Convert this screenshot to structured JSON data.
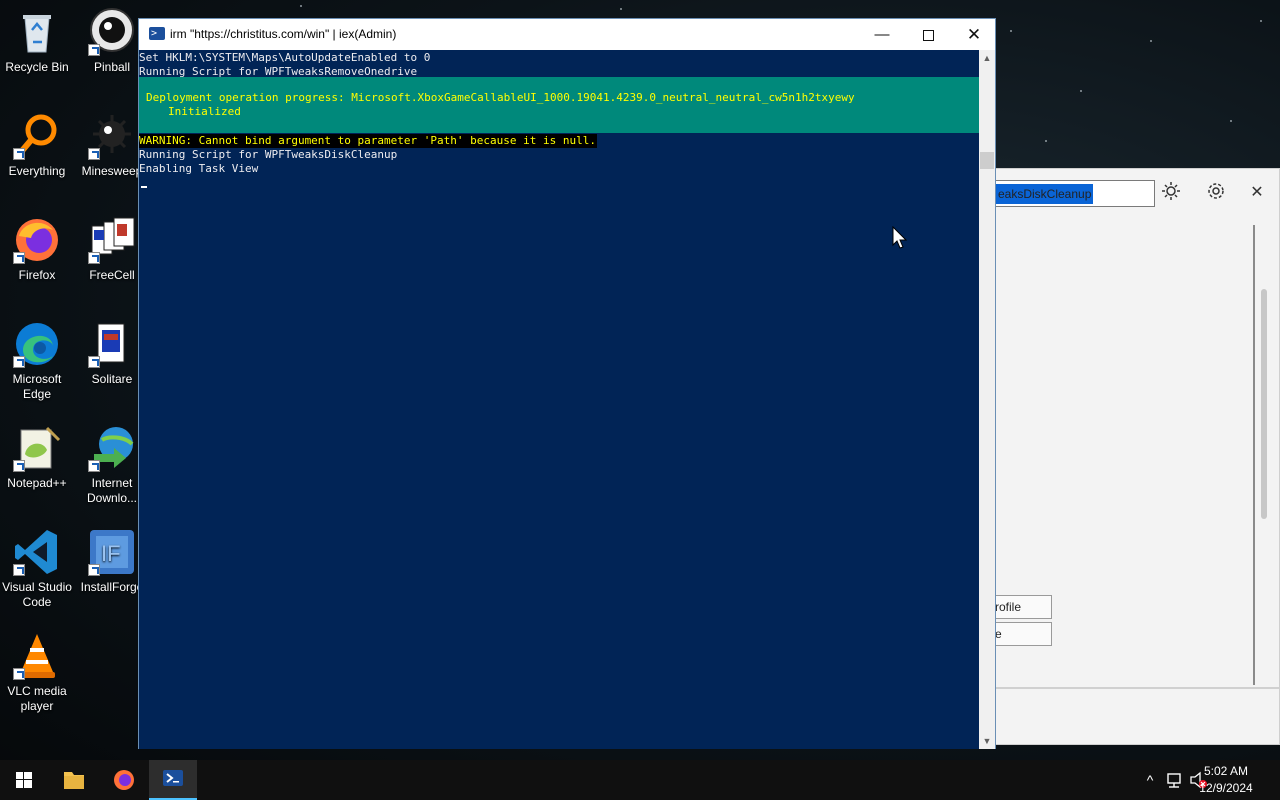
{
  "desktop": {
    "icons": [
      {
        "label": "Recycle Bin",
        "icon": "recycle-bin-icon"
      },
      {
        "label": "Pinball",
        "icon": "pinball-icon"
      },
      {
        "label": "Everything",
        "icon": "everything-icon"
      },
      {
        "label": "Minesweep",
        "icon": "minesweeper-icon"
      },
      {
        "label": "Firefox",
        "icon": "firefox-icon"
      },
      {
        "label": "FreeCell",
        "icon": "freecell-icon"
      },
      {
        "label": "Microsoft Edge",
        "icon": "edge-icon"
      },
      {
        "label": "Solitare",
        "icon": "solitaire-icon"
      },
      {
        "label": "Notepad++",
        "icon": "notepadpp-icon"
      },
      {
        "label": "Internet Downlo...",
        "icon": "idm-icon"
      },
      {
        "label": "Visual Studio Code",
        "icon": "vscode-icon"
      },
      {
        "label": "InstallForge",
        "icon": "installforge-icon"
      },
      {
        "label": "VLC media player",
        "icon": "vlc-icon"
      }
    ]
  },
  "powershell": {
    "title": "irm \"https://christitus.com/win\" | iex(Admin)",
    "lines": {
      "l1": "Set HKLM:\\SYSTEM\\Maps\\AutoUpdateEnabled to 0",
      "l2": "Running Script for WPFTweaksRemoveOnedrive",
      "progress_title": "Deployment operation progress: Microsoft.XboxGameCallableUI_1000.19041.4239.0_neutral_neutral_cw5n1h2txyewy",
      "progress_status": "Initialized",
      "warning": "WARNING: Cannot bind argument to parameter 'Path' because it is null.",
      "l3": "Running Script for WPFTweaksDiskCleanup",
      "l4": "Enabling Task View"
    },
    "colors": {
      "console_bg": "#012456",
      "progress_bg": "#00897b",
      "warning_fg": "#ffff00"
    }
  },
  "winutil": {
    "search_value": "eaksDiskCleanup",
    "button1": "rofile",
    "button2": "e"
  },
  "taskbar": {
    "time": "5:02 AM",
    "date": "12/9/2024",
    "accent": "#4cc2ff"
  }
}
